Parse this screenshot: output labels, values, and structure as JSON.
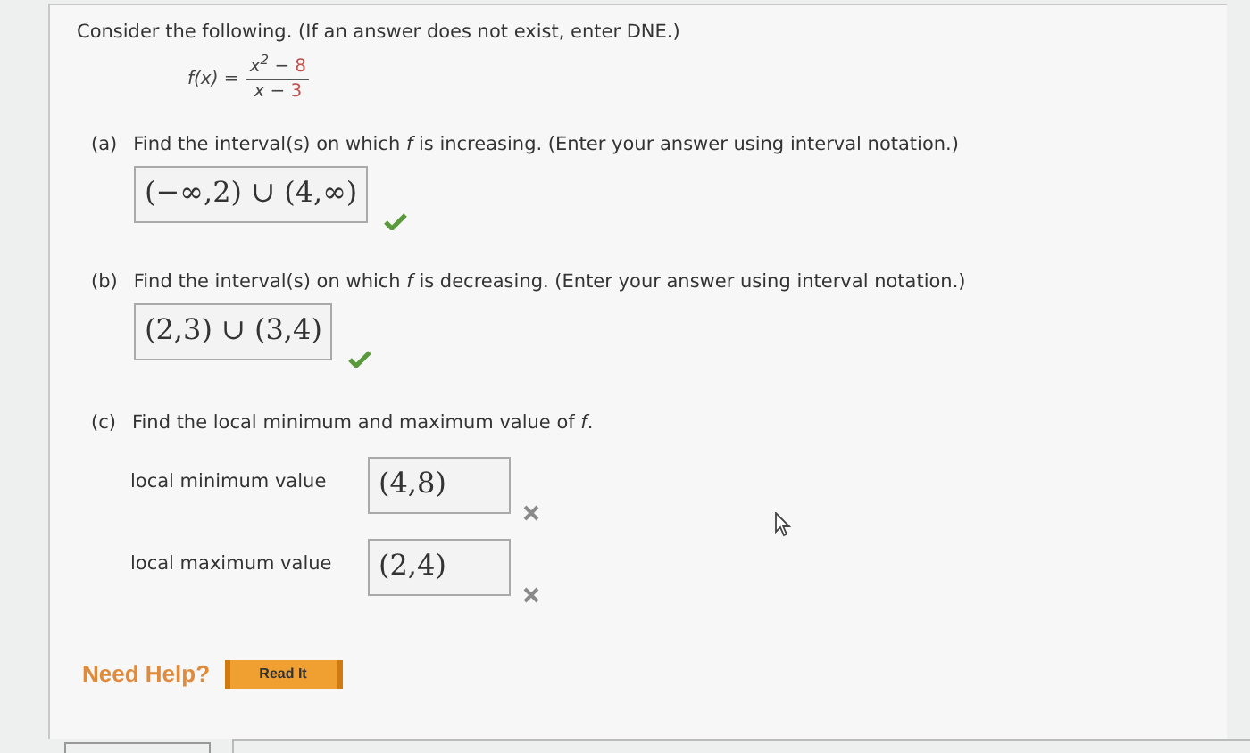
{
  "intro": "Consider the following. (If an answer does not exist, enter DNE.)",
  "function": {
    "lhs": "f(x) =",
    "numerator": {
      "expression": "x$^{2}$ −",
      "constant": "8"
    },
    "denominator": {
      "expression": "x −",
      "constant": "3"
    }
  },
  "parts": [
    {
      "label": "(a)",
      "prompt": "Find the interval(s) on which *f* is increasing. (Enter your answer using interval notation.)",
      "answers": [
        {
          "value": "(−∞,2) ∪ (4,∞)",
          "correct": true
        }
      ]
    },
    {
      "label": "(b)",
      "prompt": "Find the interval(s) on which *f* is decreasing. (Enter your answer using interval notation.)",
      "answers": [
        {
          "value": "(2,3) ∪ (3,4)",
          "correct": true
        }
      ]
    },
    {
      "label": "(c)",
      "prompt": "Find the local minimum and maximum value of *f*.",
      "answers": [
        {
          "label": "local minimum value",
          "value": "(4,8)",
          "correct": false
        },
        {
          "label": "local maximum value",
          "value": "(2,4)",
          "correct": false
        }
      ]
    }
  ],
  "help": {
    "label": "Need Help?",
    "button": "Read It"
  }
}
